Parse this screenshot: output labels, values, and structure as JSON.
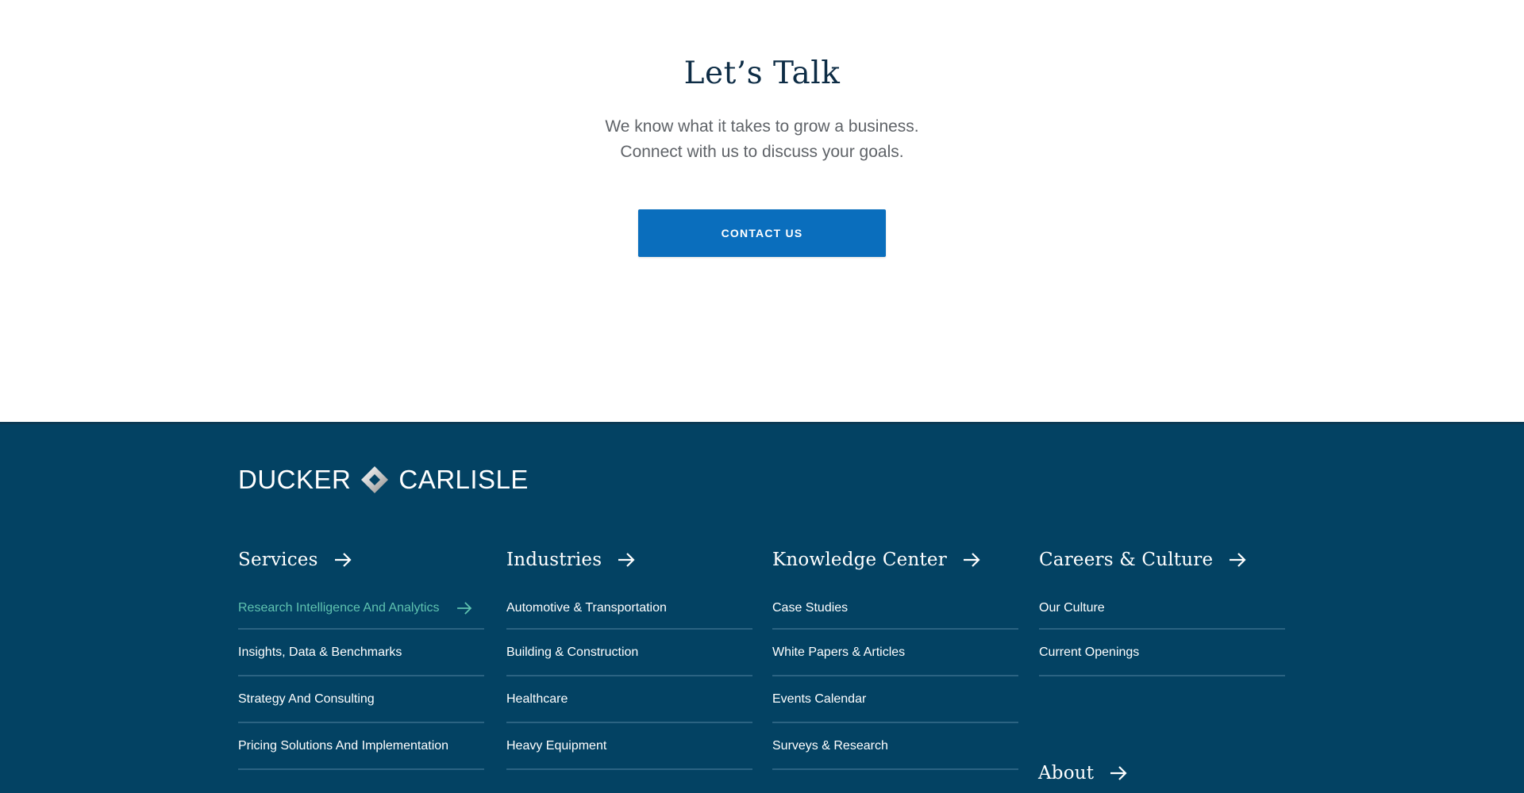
{
  "cta": {
    "icon": "teal-diamond-icon",
    "title": "Let’s Talk",
    "text_line_1": "We know what it takes to grow a business.",
    "text_line_2": "Connect with us to discuss your goals.",
    "button_label": "CONTACT US"
  },
  "footer": {
    "logo": {
      "word_left": "DUCKER",
      "word_right": "CARLISLE",
      "mark_icon": "diamond-logo-icon"
    },
    "columns": [
      {
        "heading": "Services",
        "links": [
          {
            "label": "Research Intelligence And Analytics",
            "active": true
          },
          {
            "label": "Insights, Data & Benchmarks"
          },
          {
            "label": "Strategy And Consulting"
          },
          {
            "label": "Pricing Solutions And Implementation"
          }
        ]
      },
      {
        "heading": "Industries",
        "links": [
          {
            "label": "Automotive & Transportation"
          },
          {
            "label": "Building & Construction"
          },
          {
            "label": "Healthcare"
          },
          {
            "label": "Heavy Equipment"
          }
        ]
      },
      {
        "heading": "Knowledge Center",
        "links": [
          {
            "label": "Case Studies"
          },
          {
            "label": "White Papers & Articles"
          },
          {
            "label": "Events Calendar"
          },
          {
            "label": "Surveys & Research"
          }
        ]
      },
      {
        "heading": "Careers & Culture",
        "links": [
          {
            "label": "Our Culture"
          },
          {
            "label": "Current Openings"
          }
        ]
      }
    ],
    "about": {
      "heading": "About"
    }
  },
  "colors": {
    "footer_bg": "#034263",
    "button_bg": "#0a6ebd",
    "active_link": "#5fc3b0",
    "title": "#0d2c45",
    "body_text": "#5f6368",
    "divider": "#2b6382"
  }
}
